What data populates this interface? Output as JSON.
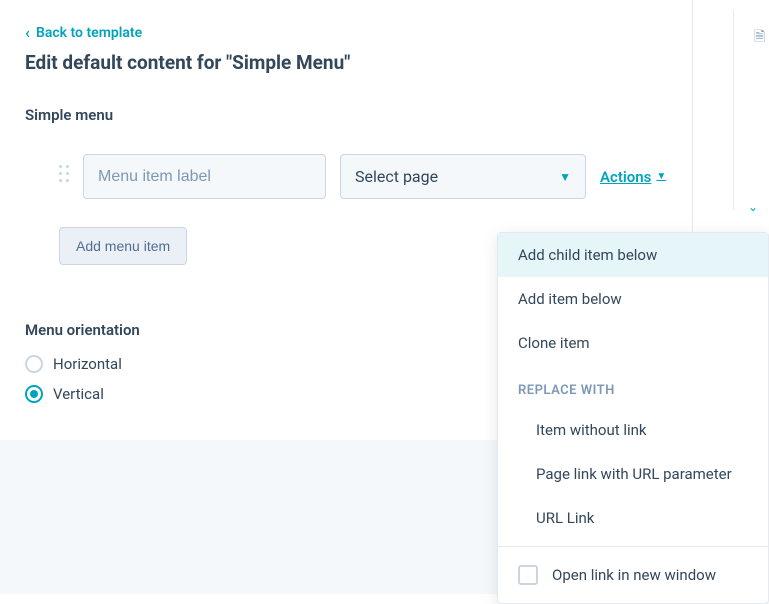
{
  "back_link": "Back to template",
  "page_title": "Edit default content for \"Simple Menu\"",
  "simple_menu_label": "Simple menu",
  "menu_item_placeholder": "Menu item label",
  "select_page_label": "Select page",
  "actions_label": "Actions",
  "add_menu_item_label": "Add menu item",
  "orientation_label": "Menu orientation",
  "orientation_options": {
    "horizontal": "Horizontal",
    "vertical": "Vertical"
  },
  "orientation_selected": "vertical",
  "dropdown": {
    "add_child_below": "Add child item below",
    "add_item_below": "Add item below",
    "clone_item": "Clone item",
    "replace_header": "REPLACE WITH",
    "item_without_link": "Item without link",
    "page_link_url_param": "Page link with URL parameter",
    "url_link": "URL Link",
    "open_new_window": "Open link in new window"
  }
}
